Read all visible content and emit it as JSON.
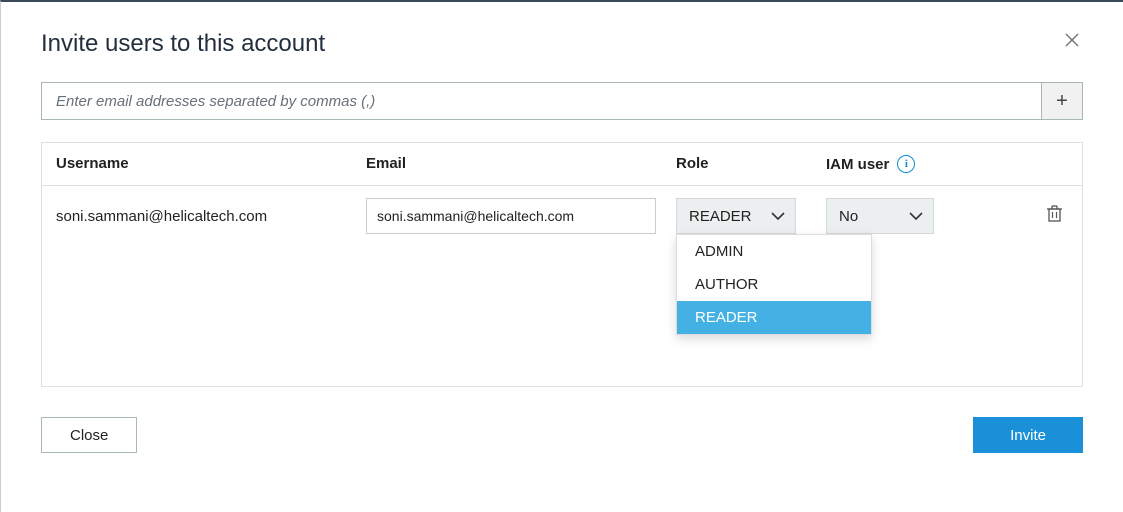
{
  "dialog": {
    "title": "Invite users to this account",
    "email_input_placeholder": "Enter email addresses separated by commas (,)",
    "add_button_label": "+",
    "columns": {
      "username": "Username",
      "email": "Email",
      "role": "Role",
      "iam": "IAM user"
    },
    "info_glyph": "i",
    "rows": [
      {
        "username": "soni.sammani@helicaltech.com",
        "email": "soni.sammani@helicaltech.com",
        "role_selected": "READER",
        "iam_selected": "No"
      }
    ],
    "role_options": [
      "ADMIN",
      "AUTHOR",
      "READER"
    ],
    "role_selected_index": 2,
    "footer": {
      "close": "Close",
      "invite": "Invite"
    }
  }
}
